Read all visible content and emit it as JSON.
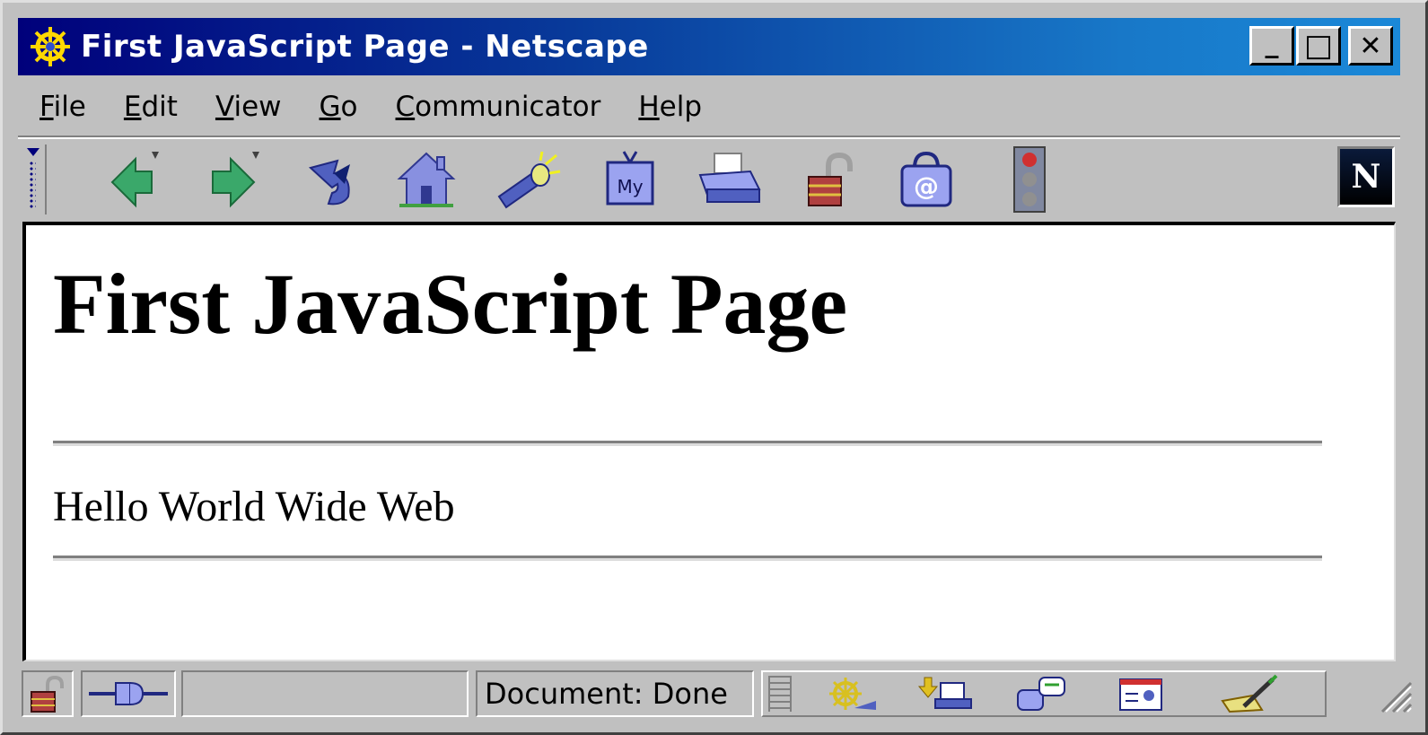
{
  "window": {
    "title": "First JavaScript Page - Netscape"
  },
  "window_controls": {
    "minimize": "_",
    "maximize": "□",
    "close": "✕"
  },
  "menu": {
    "items": [
      {
        "label": "File",
        "access_key": "F"
      },
      {
        "label": "Edit",
        "access_key": "E"
      },
      {
        "label": "View",
        "access_key": "V"
      },
      {
        "label": "Go",
        "access_key": "G"
      },
      {
        "label": "Communicator",
        "access_key": "C"
      },
      {
        "label": "Help",
        "access_key": "H"
      }
    ]
  },
  "toolbar": {
    "buttons": [
      {
        "name": "back",
        "icon": "back-arrow-icon"
      },
      {
        "name": "forward",
        "icon": "forward-arrow-icon"
      },
      {
        "name": "reload",
        "icon": "reload-icon"
      },
      {
        "name": "home",
        "icon": "home-icon"
      },
      {
        "name": "search",
        "icon": "search-flashlight-icon"
      },
      {
        "name": "my-netscape",
        "icon": "my-netscape-icon",
        "text": "My"
      },
      {
        "name": "print",
        "icon": "printer-icon"
      },
      {
        "name": "security",
        "icon": "padlock-icon"
      },
      {
        "name": "shop",
        "icon": "shopping-bag-icon",
        "text": "@"
      },
      {
        "name": "stop",
        "icon": "stop-traffic-light-icon"
      }
    ],
    "logo": "N"
  },
  "page": {
    "heading": "First JavaScript Page",
    "body_text": "Hello World Wide Web"
  },
  "status": {
    "text": "Document: Done"
  },
  "colors": {
    "titlebar_start": "#00007b",
    "titlebar_end": "#1a88d8",
    "chrome": "#c0c0c0",
    "content_bg": "#ffffff"
  }
}
